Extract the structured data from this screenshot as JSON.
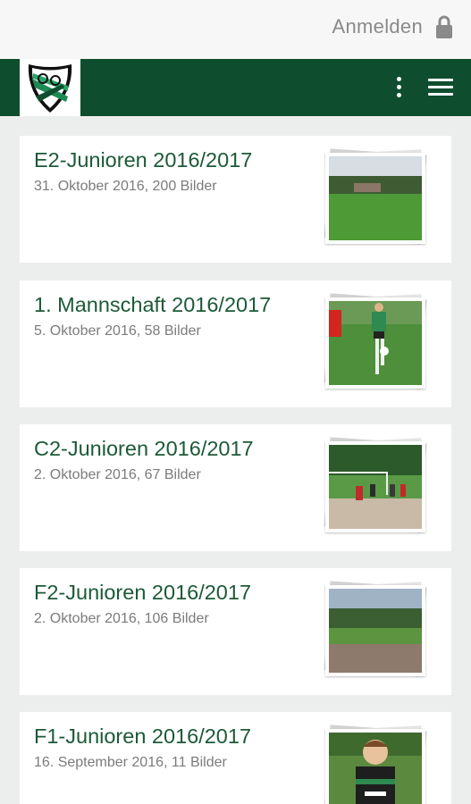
{
  "topbar": {
    "login_label": "Anmelden",
    "login_icon": "lock-icon"
  },
  "header": {
    "logo_icon": "club-crest-icon",
    "menu_icon": "hamburger-icon",
    "more_icon": "more-vertical-icon",
    "brand_color": "#0f4d2f"
  },
  "albums": [
    {
      "title": "E2-Junioren 2016/2017",
      "subtitle": "31. Oktober 2016, 200 Bilder"
    },
    {
      "title": "1. Mannschaft 2016/2017",
      "subtitle": "5. Oktober 2016, 58 Bilder"
    },
    {
      "title": "C2-Junioren 2016/2017",
      "subtitle": "2. Oktober 2016, 67 Bilder"
    },
    {
      "title": "F2-Junioren 2016/2017",
      "subtitle": "2. Oktober 2016, 106 Bilder"
    },
    {
      "title": "F1-Junioren 2016/2017",
      "subtitle": "16. September 2016, 11 Bilder"
    }
  ]
}
